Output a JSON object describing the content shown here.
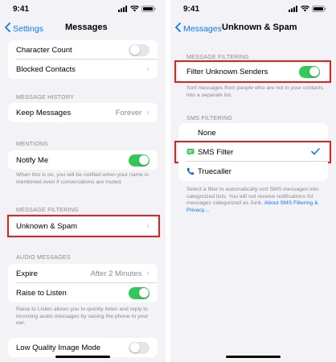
{
  "left": {
    "time": "9:41",
    "back_label": "Settings",
    "title": "Messages",
    "character_count": "Character Count",
    "blocked_contacts": "Blocked Contacts",
    "message_history_header": "MESSAGE HISTORY",
    "keep_messages": "Keep Messages",
    "keep_messages_value": "Forever",
    "mentions_header": "MENTIONS",
    "notify_me": "Notify Me",
    "notify_me_footnote": "When this is on, you will be notified when your name is mentioned even if conversations are muted.",
    "message_filtering_header": "MESSAGE FILTERING",
    "unknown_spam": "Unknown & Spam",
    "audio_messages_header": "AUDIO MESSAGES",
    "expire": "Expire",
    "expire_value": "After 2 Minutes",
    "raise_to_listen": "Raise to Listen",
    "raise_footnote": "Raise to Listen allows you to quickly listen and reply to incoming audio messages by raising the phone to your ear.",
    "low_quality": "Low Quality Image Mode"
  },
  "right": {
    "time": "9:41",
    "back_label": "Messages",
    "title": "Unknown & Spam",
    "message_filtering_header": "MESSAGE FILTERING",
    "filter_unknown_senders": "Filter Unknown Senders",
    "filter_footnote": "Sort messages from people who are not in your contacts into a separate list.",
    "sms_filtering_header": "SMS FILTERING",
    "options": [
      "None",
      "SMS Filter",
      "Truecaller"
    ],
    "selected_option": "SMS Filter",
    "sms_footnote": "Select a filter to automatically sort SMS messages into categorized lists. You will not receive notifications for messages categorized as Junk.",
    "about_link": "About SMS Filtering & Privacy…"
  },
  "colors": {
    "accent": "#0a7aff",
    "switch_on": "#34c759",
    "highlight": "#e3231b"
  }
}
